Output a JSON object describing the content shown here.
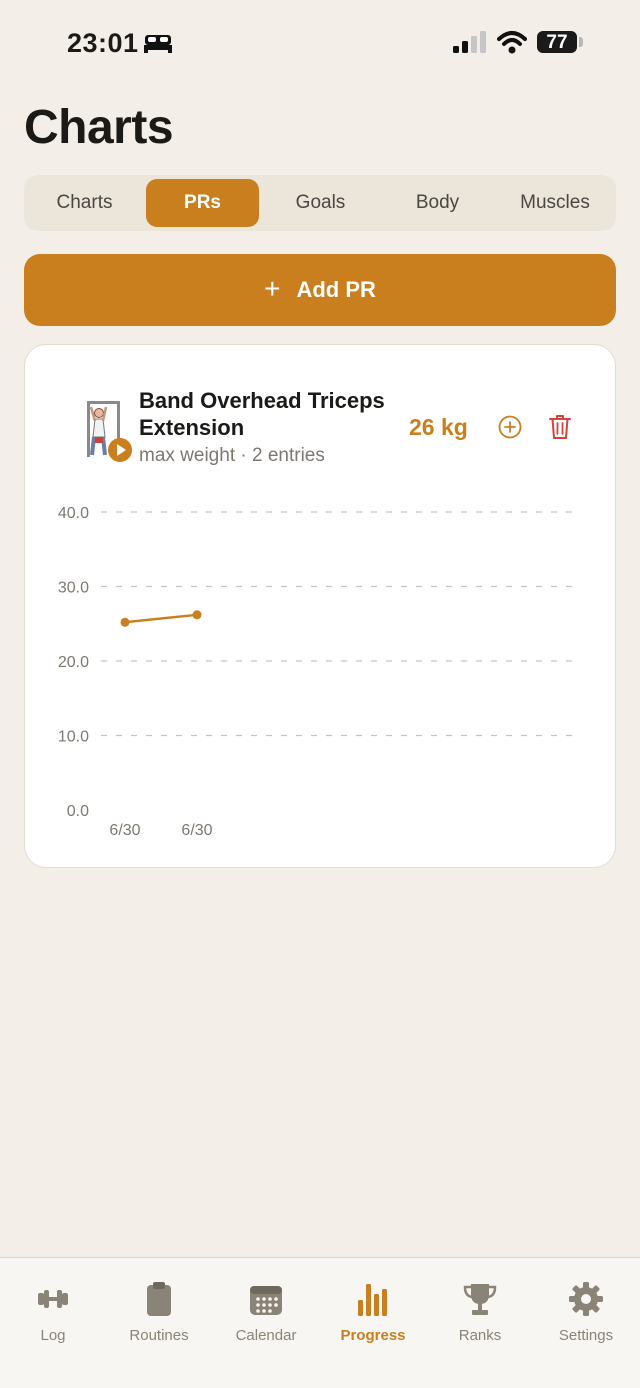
{
  "status_bar": {
    "time": "23:01",
    "battery": "77"
  },
  "page_title": "Charts",
  "tabs": [
    {
      "label": "Charts",
      "active": false
    },
    {
      "label": "PRs",
      "active": true
    },
    {
      "label": "Goals",
      "active": false
    },
    {
      "label": "Body",
      "active": false
    },
    {
      "label": "Muscles",
      "active": false
    }
  ],
  "add_button": {
    "icon": "plus-icon",
    "label": "Add PR"
  },
  "pr_card": {
    "exercise_name": "Band Overhead Triceps Extension",
    "subtitle": "max weight · 2 entries",
    "value": "26 kg",
    "actions": [
      "add-entry-icon",
      "trash-icon"
    ]
  },
  "colors": {
    "accent": "#c97f1e",
    "delete": "#d2443c",
    "background": "#f3efe8",
    "inactive": "#8a8378"
  },
  "chart_data": {
    "type": "line",
    "title": "",
    "xlabel": "",
    "ylabel": "",
    "categories": [
      "6/30",
      "6/30"
    ],
    "values": [
      25.2,
      26.2
    ],
    "ylim": [
      0,
      40
    ],
    "y_ticks": [
      "0.0",
      "10.0",
      "20.0",
      "30.0",
      "40.0"
    ],
    "grid": true
  },
  "tab_bar": [
    {
      "label": "Log",
      "icon": "dumbbell-icon",
      "active": false
    },
    {
      "label": "Routines",
      "icon": "clipboard-icon",
      "active": false
    },
    {
      "label": "Calendar",
      "icon": "calendar-icon",
      "active": false
    },
    {
      "label": "Progress",
      "icon": "bar-chart-icon",
      "active": true
    },
    {
      "label": "Ranks",
      "icon": "trophy-icon",
      "active": false
    },
    {
      "label": "Settings",
      "icon": "gear-icon",
      "active": false
    }
  ]
}
